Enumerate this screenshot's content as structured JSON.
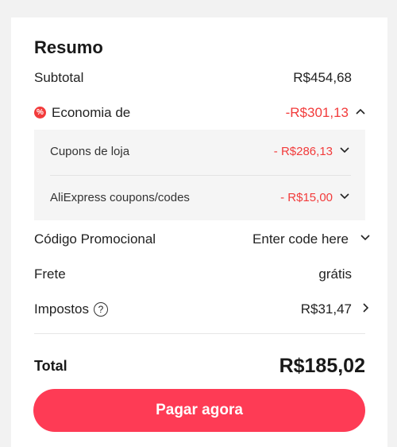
{
  "summary": {
    "title": "Resumo",
    "subtotal": {
      "label": "Subtotal",
      "value": "R$454,68"
    },
    "savings": {
      "label": "Economia de",
      "value": "-R$301,13",
      "icon": "discount-icon",
      "items": [
        {
          "label": "Cupons de loja",
          "value": "- R$286,13"
        },
        {
          "label": "AliExpress coupons/codes",
          "value": "- R$15,00"
        }
      ]
    },
    "promo": {
      "label": "Código Promocional",
      "value": "Enter code here"
    },
    "shipping": {
      "label": "Frete",
      "value": "grátis"
    },
    "taxes": {
      "label": "Impostos",
      "value": "R$31,47",
      "help": "?"
    },
    "total": {
      "label": "Total",
      "value": "R$185,02"
    },
    "pay_button": "Pagar agora"
  },
  "colors": {
    "accent": "#fe3b55",
    "discount_red": "#f23b3b",
    "panel_bg": "#f5f5f5"
  }
}
